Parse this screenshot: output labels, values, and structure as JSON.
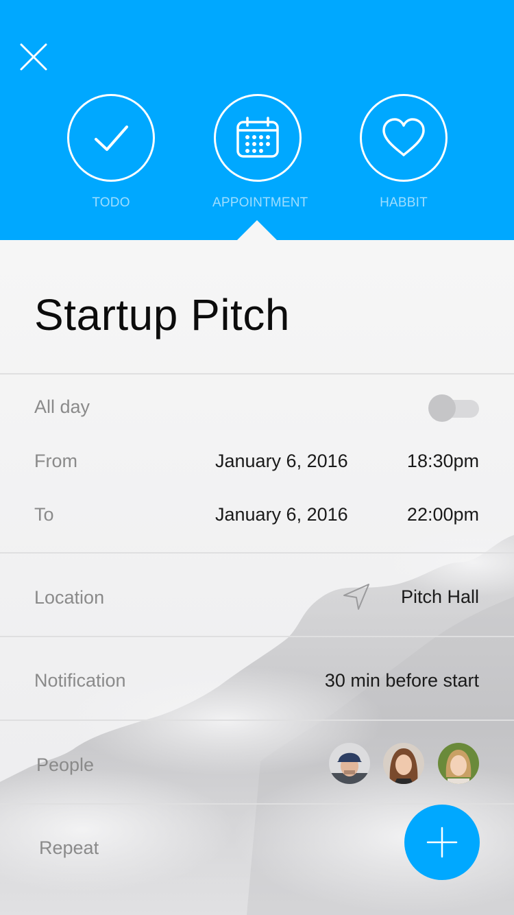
{
  "header": {
    "types": [
      {
        "label": "TODO",
        "icon": "checkmark-icon"
      },
      {
        "label": "APPOINTMENT",
        "icon": "calendar-icon"
      },
      {
        "label": "HABBIT",
        "icon": "heart-icon"
      }
    ],
    "selected": "APPOINTMENT",
    "close_icon": "close-icon"
  },
  "event": {
    "title": "Startup Pitch"
  },
  "fields": {
    "all_day": {
      "label": "All day",
      "value": false
    },
    "from": {
      "label": "From",
      "date": "January 6, 2016",
      "time": "18:30pm"
    },
    "to": {
      "label": "To",
      "date": "January 6, 2016",
      "time": "22:00pm"
    },
    "location": {
      "label": "Location",
      "value": "Pitch Hall",
      "icon": "navigation-arrow-icon"
    },
    "notification": {
      "label": "Notification",
      "value": "30 min before start"
    },
    "people": {
      "label": "People",
      "avatars": [
        "avatar-man-cap",
        "avatar-woman-brunette",
        "avatar-woman-blonde"
      ]
    },
    "repeat": {
      "label": "Repeat"
    }
  },
  "fab": {
    "icon": "plus-icon"
  },
  "colors": {
    "accent": "#00a8ff",
    "text_primary": "#1a1a1a",
    "text_label": "#8a8a8a"
  }
}
